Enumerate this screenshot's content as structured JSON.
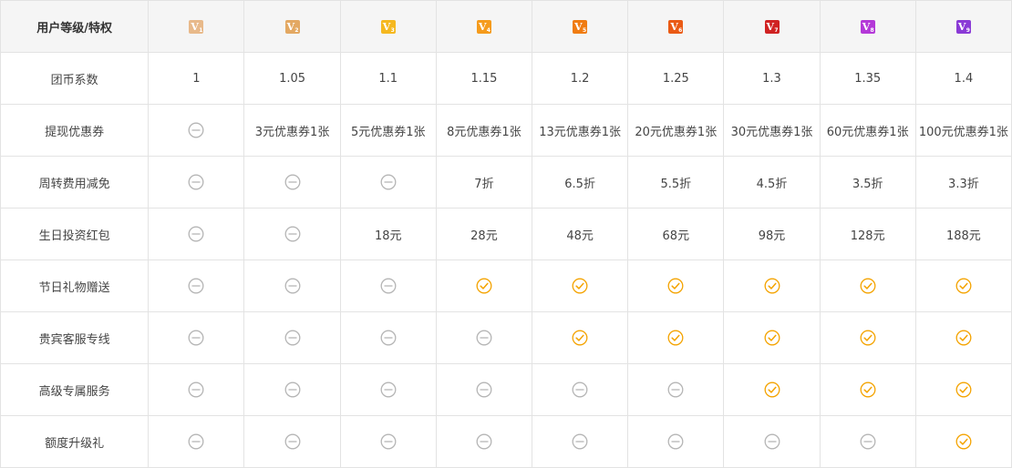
{
  "header": {
    "corner_label": "用户等级/特权",
    "levels": [
      {
        "v": "V",
        "n": "1",
        "color": "#e8b98a"
      },
      {
        "v": "V",
        "n": "2",
        "color": "#e3a862"
      },
      {
        "v": "V",
        "n": "3",
        "color": "#f5b81f"
      },
      {
        "v": "V",
        "n": "4",
        "color": "#f59b1c"
      },
      {
        "v": "V",
        "n": "5",
        "color": "#f07c12"
      },
      {
        "v": "V",
        "n": "6",
        "color": "#ea5a14"
      },
      {
        "v": "V",
        "n": "7",
        "color": "#d02222"
      },
      {
        "v": "V",
        "n": "8",
        "color": "#b438d8"
      },
      {
        "v": "V",
        "n": "9",
        "color": "#8a3ad6"
      }
    ]
  },
  "icons": {
    "no": {
      "name": "not-available-icon",
      "color": "#b5b5b5"
    },
    "yes": {
      "name": "check-circle-icon",
      "color": "#f4a300"
    }
  },
  "rows": [
    {
      "label": "团币系数",
      "cells": [
        {
          "t": "text",
          "v": "1"
        },
        {
          "t": "text",
          "v": "1.05"
        },
        {
          "t": "text",
          "v": "1.1"
        },
        {
          "t": "text",
          "v": "1.15"
        },
        {
          "t": "text",
          "v": "1.2"
        },
        {
          "t": "text",
          "v": "1.25"
        },
        {
          "t": "text",
          "v": "1.3"
        },
        {
          "t": "text",
          "v": "1.35"
        },
        {
          "t": "text",
          "v": "1.4"
        }
      ]
    },
    {
      "label": "提现优惠券",
      "cells": [
        {
          "t": "no"
        },
        {
          "t": "text",
          "v": "3元优惠券1张"
        },
        {
          "t": "text",
          "v": "5元优惠券1张"
        },
        {
          "t": "text",
          "v": "8元优惠券1张"
        },
        {
          "t": "text",
          "v": "13元优惠券1张"
        },
        {
          "t": "text",
          "v": "20元优惠券1张"
        },
        {
          "t": "text",
          "v": "30元优惠券1张"
        },
        {
          "t": "text",
          "v": "60元优惠券1张"
        },
        {
          "t": "text",
          "v": "100元优惠券1张"
        }
      ]
    },
    {
      "label": "周转费用减免",
      "cells": [
        {
          "t": "no"
        },
        {
          "t": "no"
        },
        {
          "t": "no"
        },
        {
          "t": "text",
          "v": "7折"
        },
        {
          "t": "text",
          "v": "6.5折"
        },
        {
          "t": "text",
          "v": "5.5折"
        },
        {
          "t": "text",
          "v": "4.5折"
        },
        {
          "t": "text",
          "v": "3.5折"
        },
        {
          "t": "text",
          "v": "3.3折"
        }
      ]
    },
    {
      "label": "生日投资红包",
      "cells": [
        {
          "t": "no"
        },
        {
          "t": "no"
        },
        {
          "t": "text",
          "v": "18元"
        },
        {
          "t": "text",
          "v": "28元"
        },
        {
          "t": "text",
          "v": "48元"
        },
        {
          "t": "text",
          "v": "68元"
        },
        {
          "t": "text",
          "v": "98元"
        },
        {
          "t": "text",
          "v": "128元"
        },
        {
          "t": "text",
          "v": "188元"
        }
      ]
    },
    {
      "label": "节日礼物赠送",
      "cells": [
        {
          "t": "no"
        },
        {
          "t": "no"
        },
        {
          "t": "no"
        },
        {
          "t": "yes"
        },
        {
          "t": "yes"
        },
        {
          "t": "yes"
        },
        {
          "t": "yes"
        },
        {
          "t": "yes"
        },
        {
          "t": "yes"
        }
      ]
    },
    {
      "label": "贵宾客服专线",
      "cells": [
        {
          "t": "no"
        },
        {
          "t": "no"
        },
        {
          "t": "no"
        },
        {
          "t": "no"
        },
        {
          "t": "yes"
        },
        {
          "t": "yes"
        },
        {
          "t": "yes"
        },
        {
          "t": "yes"
        },
        {
          "t": "yes"
        }
      ]
    },
    {
      "label": "高级专属服务",
      "cells": [
        {
          "t": "no"
        },
        {
          "t": "no"
        },
        {
          "t": "no"
        },
        {
          "t": "no"
        },
        {
          "t": "no"
        },
        {
          "t": "no"
        },
        {
          "t": "yes"
        },
        {
          "t": "yes"
        },
        {
          "t": "yes"
        }
      ]
    },
    {
      "label": "额度升级礼",
      "cells": [
        {
          "t": "no"
        },
        {
          "t": "no"
        },
        {
          "t": "no"
        },
        {
          "t": "no"
        },
        {
          "t": "no"
        },
        {
          "t": "no"
        },
        {
          "t": "no"
        },
        {
          "t": "no"
        },
        {
          "t": "yes"
        }
      ]
    }
  ]
}
